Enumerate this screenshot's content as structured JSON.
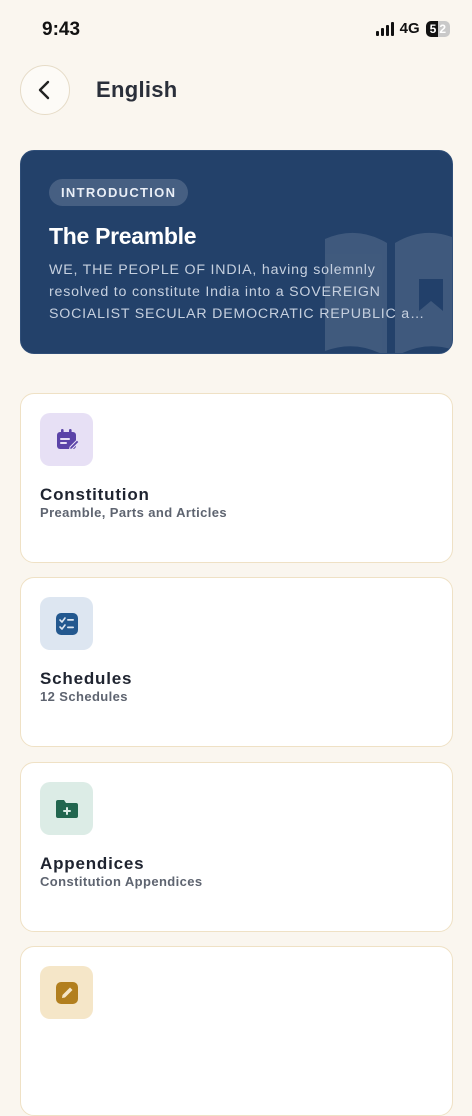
{
  "status_bar": {
    "time": "9:43",
    "network": "4G",
    "battery_level": "5",
    "battery_rest": "2"
  },
  "header": {
    "title": "English",
    "back_icon": "chevron-left-icon"
  },
  "preamble_card": {
    "badge": "INTRODUCTION",
    "title": "The Preamble",
    "text": "WE, THE PEOPLE OF INDIA, having solemnly resolved to constitute India into a SOVEREIGN SOCIALIST SECULAR DEMOCRATIC REPUBLIC and to secure to all its citizens",
    "background_color": "#23416a"
  },
  "menu": [
    {
      "title": "Constitution",
      "subtitle": "Preamble, Parts and Articles",
      "icon": "calendar-edit-icon",
      "icon_bg": "#e7e0f5",
      "icon_color": "#5b43a8"
    },
    {
      "title": "Schedules",
      "subtitle": "12 Schedules",
      "icon": "checklist-icon",
      "icon_bg": "#dde6f1",
      "icon_color": "#23588f"
    },
    {
      "title": "Appendices",
      "subtitle": "Constitution Appendices",
      "icon": "folder-add-icon",
      "icon_bg": "#dcece6",
      "icon_color": "#22664f"
    },
    {
      "title": "",
      "subtitle": "",
      "icon": "edit-icon",
      "icon_bg": "#f5e6c8",
      "icon_color": "#b27f1e"
    }
  ]
}
